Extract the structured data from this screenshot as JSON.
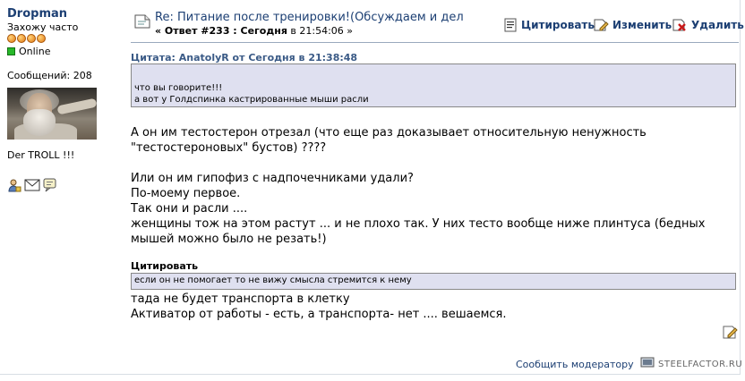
{
  "user": {
    "name": "Dropman",
    "title": "Захожу часто",
    "star_count": 4,
    "status": "Online",
    "posts_label": "Сообщений: 208",
    "signature": "Der TROLL !!!"
  },
  "post": {
    "title": "Re: Питание после тренировки!(Обсуждаем и дел",
    "subtitle_reply": "« Ответ #233 : Сегодня",
    "subtitle_time": "в 21:54:06 »",
    "actions": {
      "quote": "Цитировать",
      "edit": "Изменить",
      "delete": "Удалить"
    }
  },
  "quote1": {
    "header": "Цитата: AnatolyR от Сегодня в 21:38:48",
    "lines": [
      "что вы говорите!!!",
      "а вот у Голдспинка кастрированные мыши расли"
    ]
  },
  "body": {
    "para1": [
      "А он им тестостерон отрезал  (что еще раз доказывает относительную ненужность",
      "\"тестостероновых\" бустов) ????"
    ],
    "para2": [
      "Или он им гипофиз с надпочечниками удали?",
      "По-моему первое.",
      "Так они и расли ....",
      "женщины тож на этом растут ... и не плохо так. У них тесто вообще ниже плинтуса (бедных",
      "мышей можно было не резать!)"
    ]
  },
  "quote2": {
    "header": "Цитировать",
    "line": "если он не помогает то не вижу смысла стремится к нему"
  },
  "body2": [
    "тада не будет транспорта в клетку",
    "Активатор от работы - есть, а транспорта- нет  .... вешаемся."
  ],
  "footer": {
    "report": "Сообщить модератору",
    "watermark": "STEELFACTOR.RU"
  }
}
